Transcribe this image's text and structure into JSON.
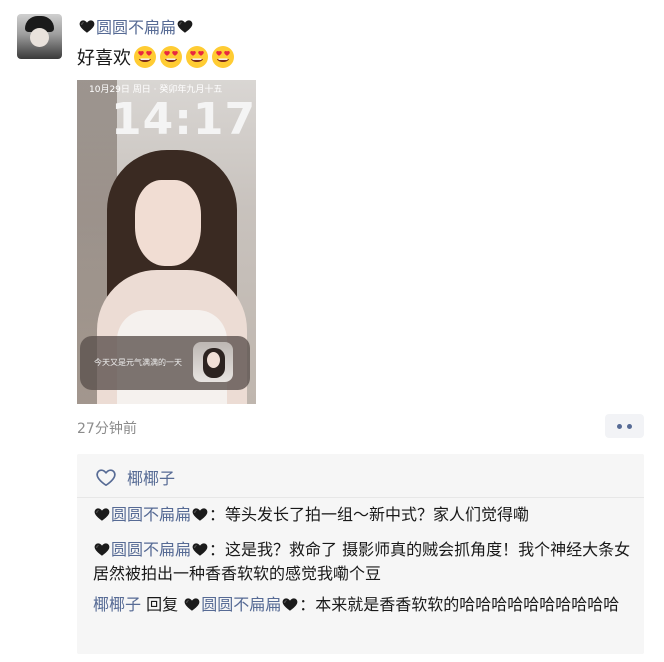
{
  "post": {
    "author": "圆圆不扁扁",
    "text": "好喜欢",
    "emoji_count": 4,
    "emoji_icon": "heart-eyes-face-icon",
    "time_ago": "27分钟前",
    "photo": {
      "date": "10月29日 周日 · 癸卯年九月十五",
      "clock": "14:17",
      "widget_text": "今天又是元气满满的一天"
    }
  },
  "likes": {
    "icon": "heart-outline-icon",
    "names": "椰椰子"
  },
  "comments": [
    {
      "author": "圆圆不扁扁",
      "text": "：等头发长了拍一组～新中式？家人们觉得嘞"
    },
    {
      "author": "圆圆不扁扁",
      "text": "：这是我？救命了 摄影师真的贼会抓角度！我个神经大条女居然被拍出一种香香软软的感觉我嘞个豆"
    },
    {
      "author": "椰椰子",
      "reply_label": "回复",
      "reply_to": "圆圆不扁扁",
      "text": "：本来就是香香软软的哈哈哈哈哈哈哈哈哈哈"
    }
  ],
  "colors": {
    "link": "#576b95",
    "text": "#191919",
    "muted": "#8c8c8c",
    "panel": "#f6f6f6"
  }
}
